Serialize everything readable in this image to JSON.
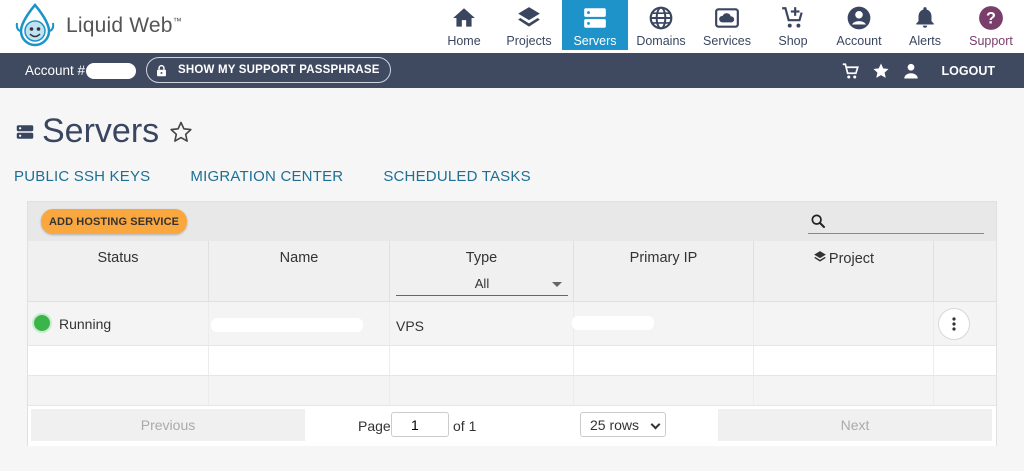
{
  "brand": {
    "name": "Liquid Web",
    "tm": "™"
  },
  "nav": {
    "items": [
      {
        "label": "Home",
        "icon": "home-icon"
      },
      {
        "label": "Projects",
        "icon": "layers-icon"
      },
      {
        "label": "Servers",
        "icon": "server-icon",
        "active": true
      },
      {
        "label": "Domains",
        "icon": "globe-icon"
      },
      {
        "label": "Services",
        "icon": "cloud-icon"
      },
      {
        "label": "Shop",
        "icon": "cart-plus-icon"
      },
      {
        "label": "Account",
        "icon": "user-circle-icon"
      },
      {
        "label": "Alerts",
        "icon": "bell-icon"
      },
      {
        "label": "Support",
        "icon": "help-icon"
      }
    ]
  },
  "account_bar": {
    "account_label": "Account #",
    "passphrase_label": "SHOW MY SUPPORT PASSPHRASE",
    "logout_label": "LOGOUT"
  },
  "page": {
    "title": "Servers",
    "sublinks": [
      "PUBLIC SSH KEYS",
      "MIGRATION CENTER",
      "SCHEDULED TASKS"
    ]
  },
  "table": {
    "add_button": "ADD HOSTING SERVICE",
    "search_placeholder": "",
    "columns": {
      "status": "Status",
      "name": "Name",
      "type": "Type",
      "type_filter": "All",
      "primary_ip": "Primary IP",
      "project": "Project"
    },
    "rows": [
      {
        "status": "Running",
        "type": "VPS"
      }
    ]
  },
  "pager": {
    "previous": "Previous",
    "page_label": "Page",
    "page_value": "1",
    "of_label": "of 1",
    "rows_option": "25 rows",
    "next": "Next"
  },
  "colors": {
    "accent": "#1d93c9",
    "account_bar": "#3f4a60",
    "add_button": "#f9a73e",
    "status_running": "#3bb54a",
    "link": "#1d6f95"
  }
}
